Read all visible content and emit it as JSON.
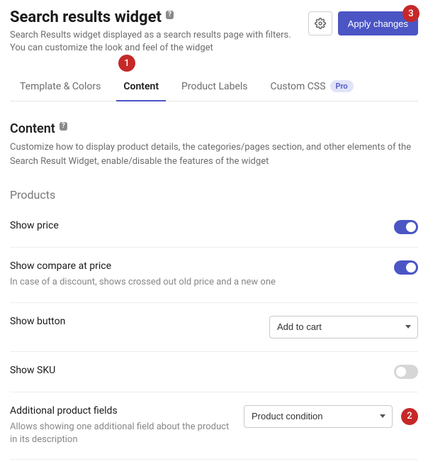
{
  "header": {
    "title": "Search results widget",
    "badge": "?",
    "description": "Search Results widget displayed as a search results page with filters. You can customize the look and feel of the widget"
  },
  "actions": {
    "apply_label": "Apply changes"
  },
  "tabs": {
    "template_colors": "Template & Colors",
    "content": "Content",
    "product_labels": "Product Labels",
    "custom_css": "Custom CSS",
    "pro_badge": "Pro"
  },
  "section": {
    "title": "Content",
    "badge": "?",
    "description": "Customize how to display product details, the categories/pages section, and other elements of the Search Result Widget, enable/disable the features of the widget"
  },
  "subsection": {
    "products": "Products"
  },
  "settings": {
    "show_price": {
      "label": "Show price"
    },
    "show_compare": {
      "label": "Show compare at price",
      "help": "In case of a discount, shows crossed out old price and a new one"
    },
    "show_button": {
      "label": "Show button",
      "value": "Add to cart"
    },
    "show_sku": {
      "label": "Show SKU"
    },
    "additional_fields": {
      "label": "Additional product fields",
      "value": "Product condition",
      "help": "Allows showing one additional field about the product in its description"
    }
  },
  "callouts": {
    "c1": "1",
    "c2": "2",
    "c3": "3"
  }
}
